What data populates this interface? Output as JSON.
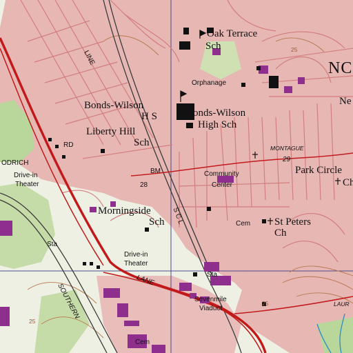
{
  "map": {
    "colors": {
      "urban": "#e7b7b4",
      "urban_grid": "#d27e7e",
      "background": "#eef0e4",
      "vegetation": "#b9d69b",
      "major_road": "#c21a1a",
      "railroad": "#3a3a3a",
      "building_purple": "#8e2f8e",
      "contour_brown": "#b7794e",
      "water_blue": "#2c8ac4",
      "survey_line": "#4a4a8a"
    },
    "labels": {
      "oak_terrace_1": "Oak Terrace",
      "oak_terrace_2": "Sch",
      "no_partial": "NC",
      "orphanage": "Orphanage",
      "ne_partial": "Ne",
      "bonds_wilson_hs_1": "Bonds-Wilson",
      "bonds_wilson_hs_2": "H S",
      "bonds_wilson_high_1": "Bonds-Wilson",
      "bonds_wilson_high_2": "High Sch",
      "liberty_hill_1": "Liberty Hill",
      "liberty_hill_2": "Sch",
      "rd": "RD",
      "odrich": "ODRICH",
      "montague": "MONTAGUE",
      "num_29": "29",
      "park_circle_1": "Park Circle",
      "park_circle_2": "Ch",
      "bm": "BM",
      "num_28": "28",
      "community_center_1": "Community",
      "community_center_2": "Center",
      "drive_in_1_a": "Drive-in",
      "drive_in_1_b": "Theater",
      "morningside_1": "Morningside",
      "morningside_2": "Sch",
      "cem_1": "Cem",
      "st_peters_1": "St Peters",
      "st_peters_2": "Ch",
      "line_label": "LINE",
      "scl": "S C L",
      "sta_1": "Sta",
      "drive_in_2_a": "Drive-in",
      "drive_in_2_b": "Theater",
      "lane": "LANE",
      "sta_2": "Sta",
      "sevenmile_1": "Sevenmile",
      "sevenmile_2": "Viaduct",
      "southern": "SOUTHERN",
      "laur": "LAUR",
      "num_25_a": "25",
      "num_25_b": "25",
      "num_25_c": "25",
      "cem_2": "Cem"
    }
  }
}
